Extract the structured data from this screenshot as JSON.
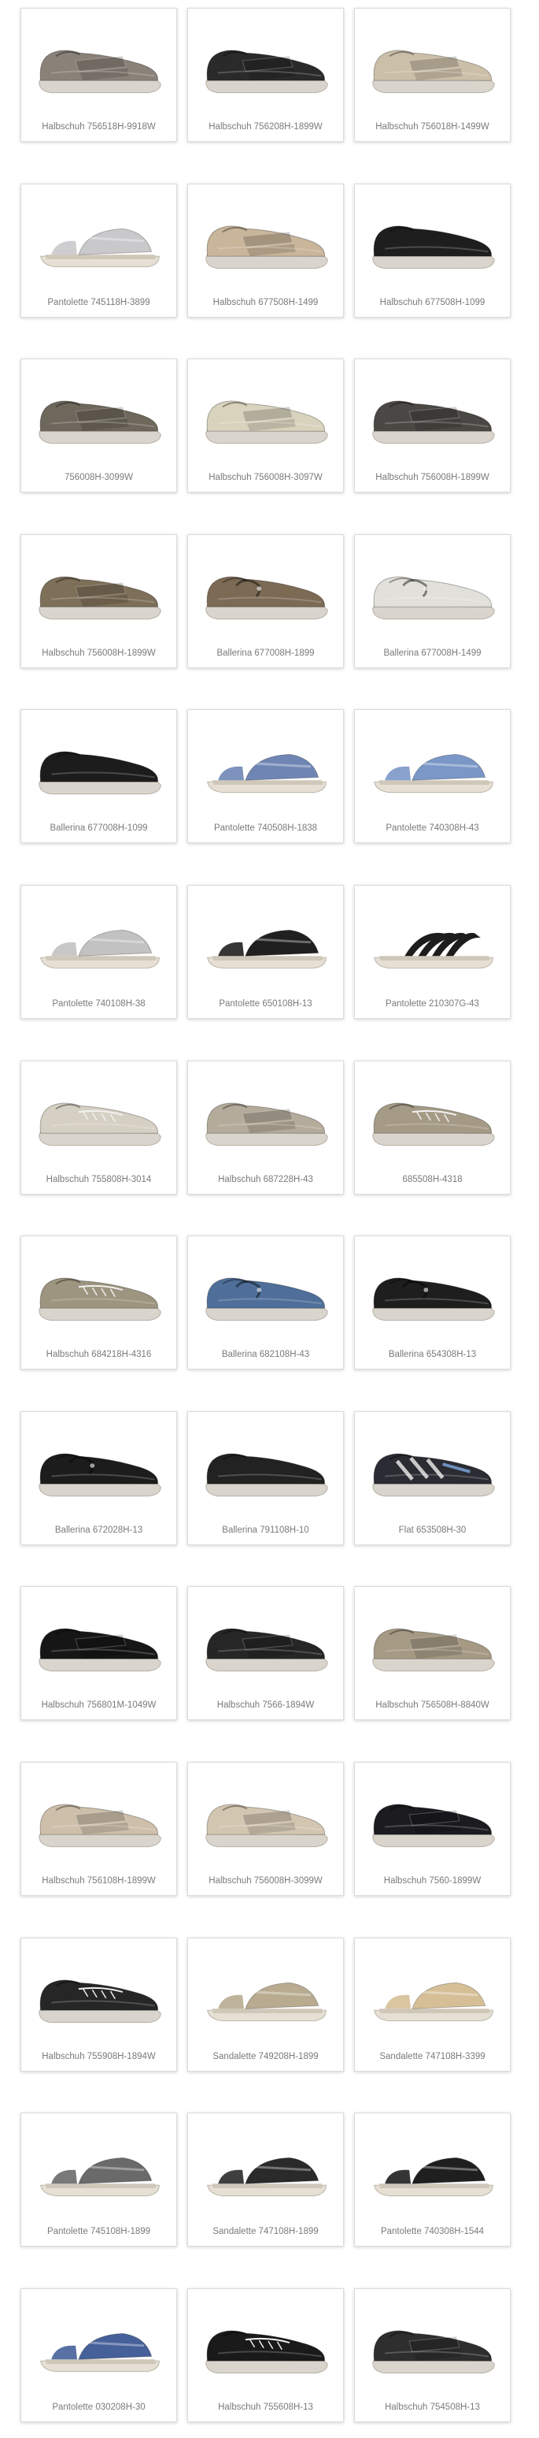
{
  "products": [
    {
      "name": "Halbschuh 756518H-9918W",
      "style": "velcro",
      "color": "#8a8178"
    },
    {
      "name": "Halbschuh 756208H-1899W",
      "style": "velcro",
      "color": "#2a2a2a"
    },
    {
      "name": "Halbschuh 756018H-1499W",
      "style": "velcro",
      "color": "#cbbfa8"
    },
    {
      "name": "Pantolette 745118H-3899",
      "style": "sandal",
      "color": "#c9c9cc"
    },
    {
      "name": "Halbschuh 677508H-1499",
      "style": "velcro",
      "color": "#c8b59a"
    },
    {
      "name": "Halbschuh 677508H-1099",
      "style": "plain",
      "color": "#1e1e1e"
    },
    {
      "name": "756008H-3099W",
      "style": "velcro",
      "color": "#6e675c"
    },
    {
      "name": "Halbschuh 756008H-3097W",
      "style": "velcro",
      "color": "#d9d2bd"
    },
    {
      "name": "Halbschuh 756008H-1899W",
      "style": "velcro",
      "color": "#4a4744"
    },
    {
      "name": "Halbschuh 756008H-1899W",
      "style": "velcro",
      "color": "#7d6f58"
    },
    {
      "name": "Ballerina 677008H-1899",
      "style": "ballerina",
      "color": "#7c6a55"
    },
    {
      "name": "Ballerina 677008H-1499",
      "style": "ballerina",
      "color": "#e2e0da"
    },
    {
      "name": "Ballerina 677008H-1099",
      "style": "plain",
      "color": "#1c1c1c"
    },
    {
      "name": "Pantolette 740508H-1838",
      "style": "sandal",
      "color": "#6f86b5"
    },
    {
      "name": "Pantolette 740308H-43",
      "style": "sandal",
      "color": "#7b97c8"
    },
    {
      "name": "Pantolette 740108H-38",
      "style": "sandal",
      "color": "#c2c2c2"
    },
    {
      "name": "Pantolette 650108H-13",
      "style": "sandal",
      "color": "#202020"
    },
    {
      "name": "Pantolette 210307G-43",
      "style": "strappy",
      "color": "#1d1d1d"
    },
    {
      "name": "Halbschuh 755808H-3014",
      "style": "laced",
      "color": "#d6d0c4"
    },
    {
      "name": "Halbschuh 687228H-43",
      "style": "velcro",
      "color": "#b5ab9a"
    },
    {
      "name": "685508H-4318",
      "style": "laced",
      "color": "#a59a86"
    },
    {
      "name": "Halbschuh 684218H-4316",
      "style": "laced",
      "color": "#9d957f"
    },
    {
      "name": "Ballerina 682108H-43",
      "style": "ballerina",
      "color": "#4f6f9a"
    },
    {
      "name": "Ballerina 654308H-13",
      "style": "ballerina",
      "color": "#1e1e1e"
    },
    {
      "name": "Ballerina 672028H-13",
      "style": "ballerina",
      "color": "#1c1c1c"
    },
    {
      "name": "Ballerina 791108H-10",
      "style": "plain",
      "color": "#222222"
    },
    {
      "name": "Flat 653508H-30",
      "style": "sporty",
      "color": "#2b2b33"
    },
    {
      "name": "Halbschuh 756801M-1049W",
      "style": "velcro",
      "color": "#161616"
    },
    {
      "name": "Halbschuh 7566-1894W",
      "style": "velcro",
      "color": "#262626"
    },
    {
      "name": "Halbschuh 756508H-8840W",
      "style": "velcro",
      "color": "#a69a85"
    },
    {
      "name": "Halbschuh 756108H-1899W",
      "style": "velcro",
      "color": "#cdbfaa"
    },
    {
      "name": "Halbschuh 756008H-3099W",
      "style": "velcro",
      "color": "#d3c6b1"
    },
    {
      "name": "Halbschuh 7560-1899W",
      "style": "velcro",
      "color": "#1b1b20"
    },
    {
      "name": "Halbschuh 755908H-1894W",
      "style": "laced",
      "color": "#262626"
    },
    {
      "name": "Sandalette 749208H-1899",
      "style": "sandal",
      "color": "#b8ab90"
    },
    {
      "name": "Sandalette 747108H-3399",
      "style": "sandal",
      "color": "#d6bf97"
    },
    {
      "name": "Pantolette 745108H-1899",
      "style": "sandal",
      "color": "#6a6a6a"
    },
    {
      "name": "Sandalette 747108H-1899",
      "style": "sandal",
      "color": "#2a2a2a"
    },
    {
      "name": "Pantolette 740308H-1544",
      "style": "sandal",
      "color": "#1f1f1f"
    },
    {
      "name": "Pantolette 030208H-30",
      "style": "sandal",
      "color": "#46609a"
    },
    {
      "name": "Halbschuh 755608H-13",
      "style": "laced",
      "color": "#1a1a1a"
    },
    {
      "name": "Halbschuh 754508H-13",
      "style": "velcro",
      "color": "#2e2e2e"
    }
  ]
}
